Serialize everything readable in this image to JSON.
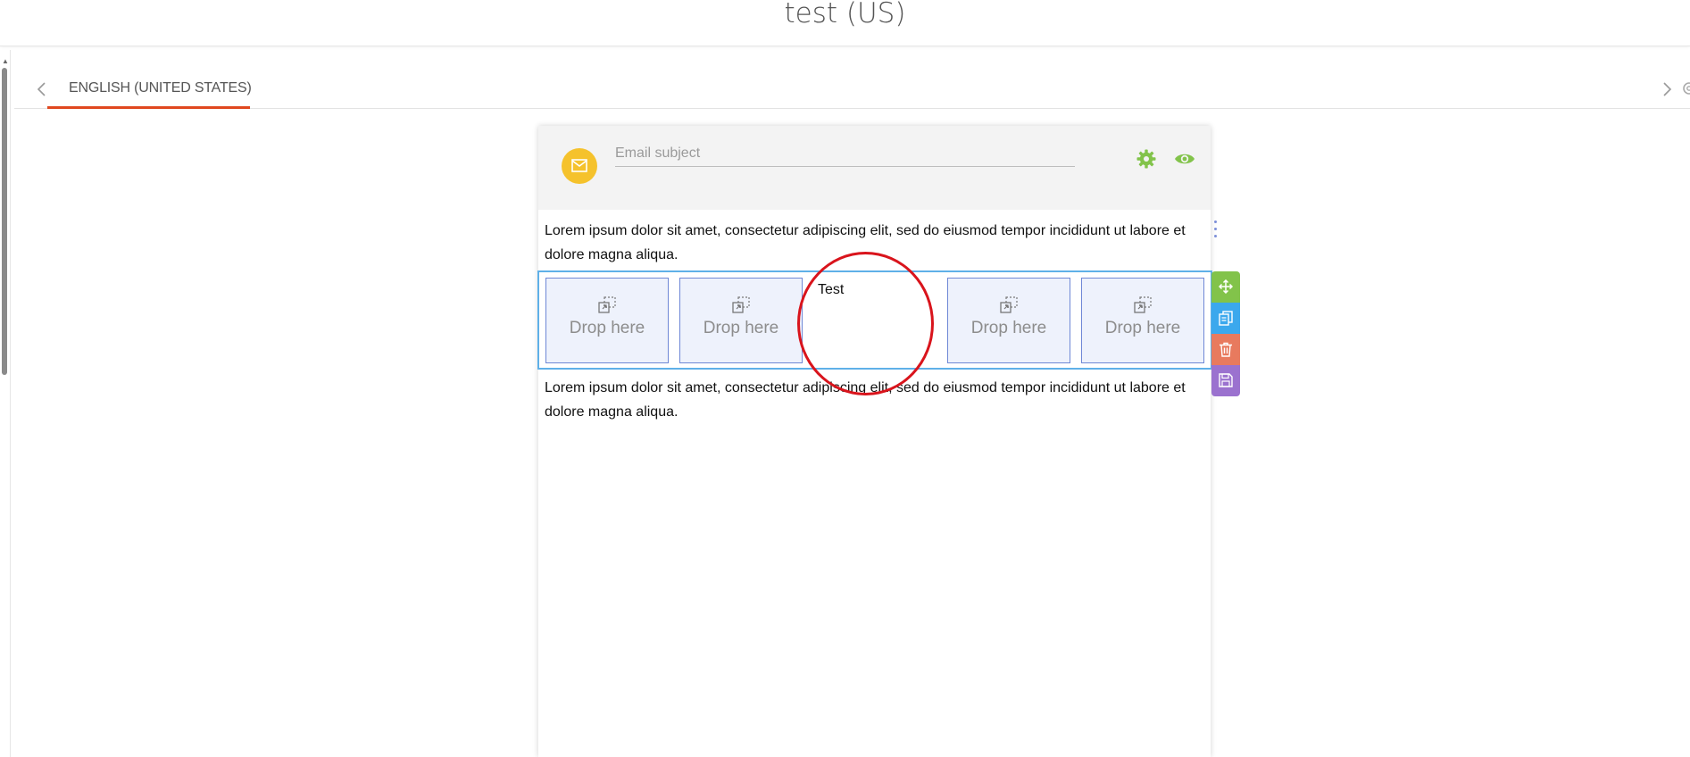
{
  "page": {
    "title": "test (US)"
  },
  "tabs": {
    "active_label": "ENGLISH (UNITED STATES)"
  },
  "email": {
    "subject_placeholder": "Email subject",
    "subject_value": "",
    "paragraph_top": "Lorem ipsum dolor sit amet, consectetur adipiscing elit, sed do eiusmod tempor incididunt ut labore et dolore magna aliqua.",
    "paragraph_bottom": "Lorem ipsum dolor sit amet, consectetur adipiscing elit, sed do eiusmod tempor incididunt ut labore et dolore magna aliqua.",
    "columns": [
      {
        "label": "Drop here"
      },
      {
        "label": "Drop here"
      },
      {
        "label": "Test"
      },
      {
        "label": "Drop here"
      },
      {
        "label": "Drop here"
      }
    ]
  },
  "icons": {
    "mail": "envelope-icon",
    "settings": "gear-icon",
    "preview": "eye-icon",
    "move": "move-icon",
    "copy": "copy-icon",
    "delete": "trash-icon",
    "save": "save-icon",
    "drop": "drop-target-icon"
  },
  "colors": {
    "accent_tab": "#e0481f",
    "avatar": "#f5c22c",
    "action_green": "#82c34a",
    "row_selection": "#5fb0e8",
    "drop_border": "#6f88d6",
    "tool_copy": "#3ba8ed",
    "tool_delete": "#e87a5e",
    "tool_save": "#9b72cf",
    "annotation": "#d9141c"
  }
}
